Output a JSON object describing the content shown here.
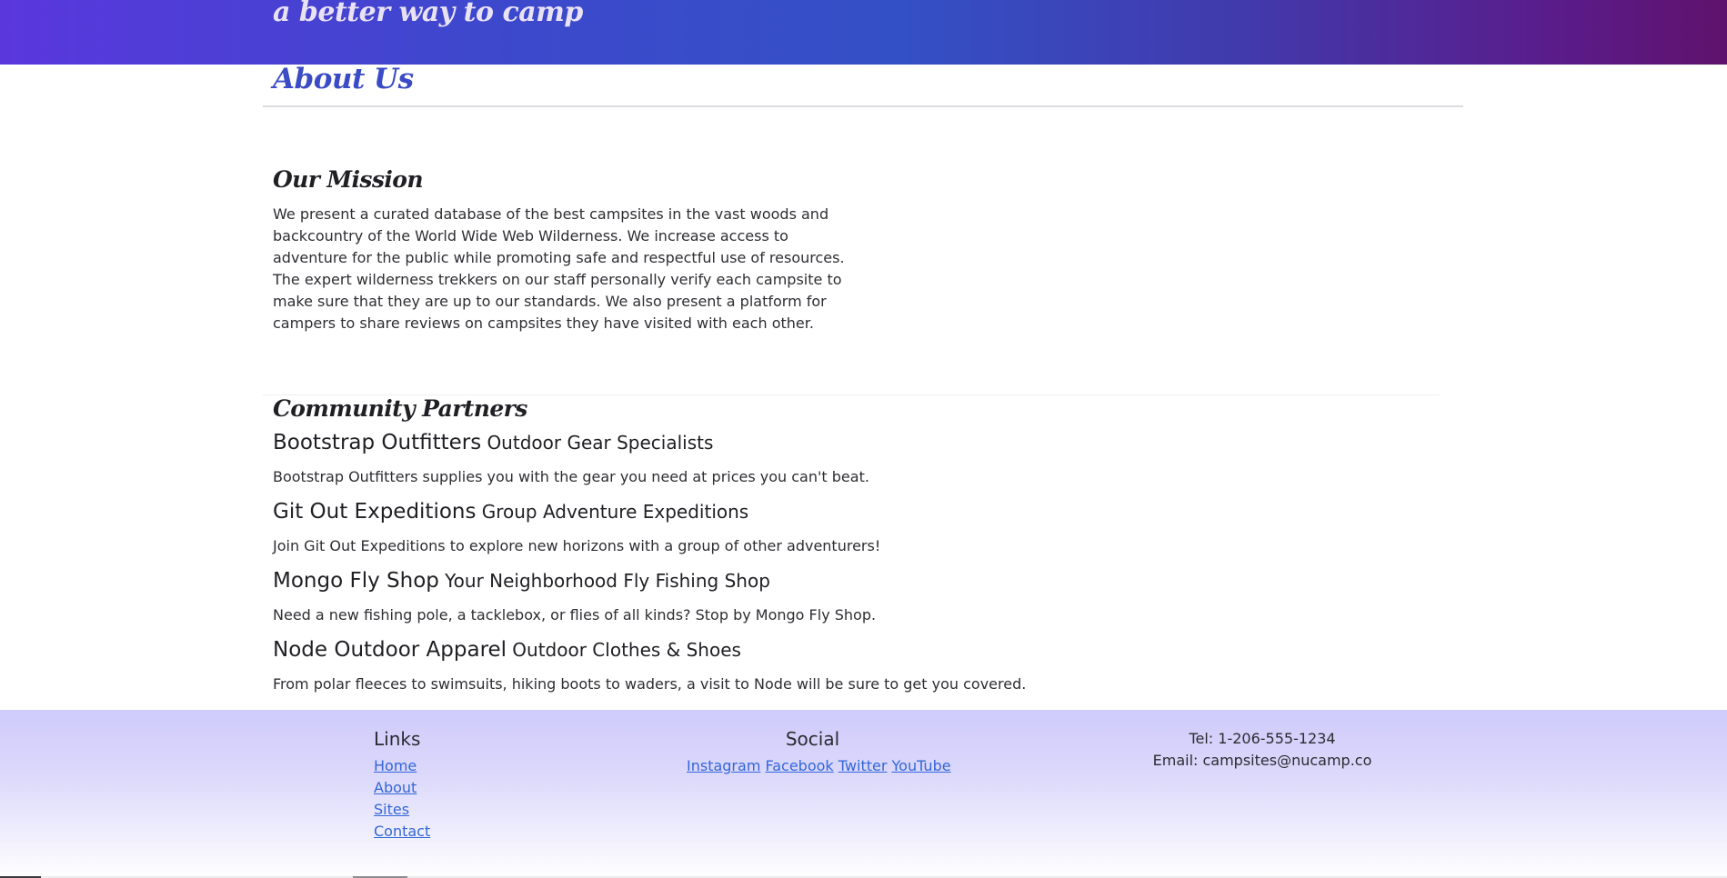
{
  "header": {
    "tagline": "a better way to camp",
    "gradient_colors": [
      "#5a37dd",
      "#3450c6",
      "#5f126c"
    ]
  },
  "page": {
    "title": "About Us",
    "title_color": "#3a4bc5"
  },
  "mission": {
    "heading": "Our Mission",
    "text": "We present a curated database of the best campsites in the vast woods and backcountry of the World Wide Web Wilderness. We increase access to adventure for the public while promoting safe and respectful use of resources. The expert wilderness trekkers on our staff personally verify each campsite to make sure that they are up to our standards. We also present a platform for campers to share reviews on campsites they have visited with each other."
  },
  "partners": {
    "heading": "Community Partners",
    "items": [
      {
        "name": "Bootstrap Outfitters",
        "tagline": "Outdoor Gear Specialists",
        "description": "Bootstrap Outfitters supplies you with the gear you need at prices you can't beat."
      },
      {
        "name": "Git Out Expeditions",
        "tagline": "Group Adventure Expeditions",
        "description": "Join Git Out Expeditions to explore new horizons with a group of other adventurers!"
      },
      {
        "name": "Mongo Fly Shop",
        "tagline": "Your Neighborhood Fly Fishing Shop",
        "description": "Need a new fishing pole, a tacklebox, or flies of all kinds? Stop by Mongo Fly Shop."
      },
      {
        "name": "Node Outdoor Apparel",
        "tagline": "Outdoor Clothes & Shoes",
        "description": "From polar fleeces to swimsuits, hiking boots to waders, a visit to Node will be sure to get you covered."
      }
    ]
  },
  "footer": {
    "links_heading": "Links",
    "links": [
      "Home",
      "About",
      "Sites",
      "Contact"
    ],
    "social_heading": "Social",
    "social": [
      "Instagram",
      "Facebook",
      "Twitter",
      "YouTube"
    ],
    "contact": {
      "tel": "Tel: 1-206-555-1234",
      "email": "Email: campsites@nucamp.co"
    },
    "link_color": "#3467d8",
    "background_color": "#cfcbfb"
  }
}
